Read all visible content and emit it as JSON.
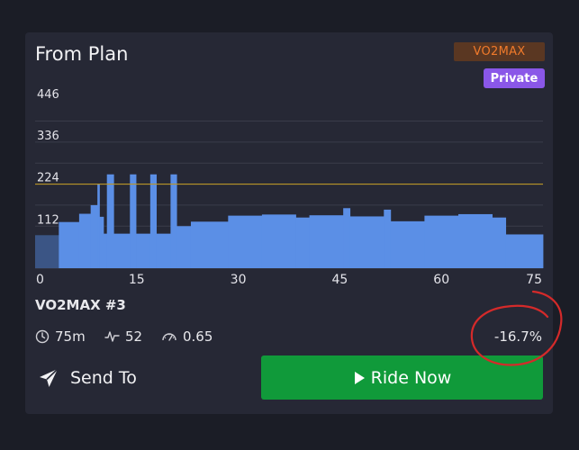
{
  "card": {
    "title": "From Plan",
    "type_badge": "VO2MAX",
    "privacy_badge": "Private"
  },
  "chart_data": {
    "type": "area",
    "ylabel_ticks": [
      446,
      336,
      224,
      112
    ],
    "x_ticks": [
      0,
      15,
      30,
      45,
      60,
      75
    ],
    "xlim": [
      0,
      75
    ],
    "ylim": [
      0,
      446
    ],
    "threshold": 224,
    "current_segment_end": 3.5,
    "steps": [
      [
        0,
        3.5,
        88
      ],
      [
        3.5,
        6.5,
        123
      ],
      [
        6.5,
        8.2,
        145
      ],
      [
        8.2,
        9.2,
        168
      ],
      [
        9.2,
        9.5,
        224
      ],
      [
        9.5,
        10.1,
        137
      ],
      [
        10.1,
        10.6,
        92
      ],
      [
        10.6,
        11.6,
        250
      ],
      [
        11.6,
        14,
        92
      ],
      [
        14,
        14.9,
        250
      ],
      [
        14.9,
        17,
        92
      ],
      [
        17,
        17.9,
        250
      ],
      [
        17.9,
        20,
        92
      ],
      [
        20,
        20.9,
        250
      ],
      [
        20.9,
        23,
        112
      ],
      [
        23,
        28.5,
        124
      ],
      [
        28.5,
        33.5,
        140
      ],
      [
        33.5,
        38.5,
        143
      ],
      [
        38.5,
        40.5,
        135
      ],
      [
        40.5,
        45.5,
        141
      ],
      [
        45.5,
        46.5,
        160
      ],
      [
        46.5,
        51.5,
        138
      ],
      [
        51.5,
        52.5,
        156
      ],
      [
        52.5,
        57.5,
        125
      ],
      [
        57.5,
        62.5,
        140
      ],
      [
        62.5,
        67.5,
        144
      ],
      [
        67.5,
        69.5,
        135
      ],
      [
        69.5,
        75,
        90
      ]
    ]
  },
  "workout": {
    "name": "VO2MAX #3",
    "duration": "75m",
    "tss": "52",
    "intensity": "0.65",
    "delta": "-16.7%"
  },
  "actions": {
    "send_to": "Send To",
    "ride_now": "Ride Now"
  },
  "colors": {
    "bar": "#5b8fe6",
    "bar_current": "#3b5585",
    "threshold": "#b89428",
    "grid": "#3a3c4a",
    "annotation": "#d42a2a"
  }
}
